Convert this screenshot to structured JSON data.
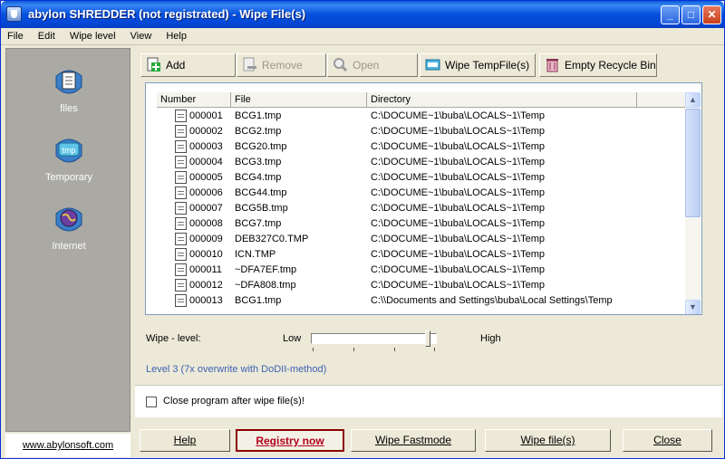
{
  "window": {
    "title": "abylon SHREDDER (not registrated) - Wipe File(s)",
    "buttons": {
      "minimize": "_",
      "maximize": "□",
      "close": "✕"
    }
  },
  "menu": [
    "File",
    "Edit",
    "Wipe level",
    "View",
    "Help"
  ],
  "sidebar": {
    "items": [
      {
        "label": "files",
        "icon": "files-icon"
      },
      {
        "label": "Temporary",
        "icon": "tmp-icon"
      },
      {
        "label": "Internet",
        "icon": "internet-icon"
      }
    ],
    "link": "www.abylonsoft.com"
  },
  "toolbar": {
    "add": "Add",
    "remove": "Remove",
    "open": "Open",
    "wipe_temp": "Wipe TempFile(s)",
    "empty_bin": "Empty Recycle Bin"
  },
  "list": {
    "headers": {
      "number": "Number",
      "file": "File",
      "directory": "Directory"
    },
    "rows": [
      {
        "num": "000001",
        "file": "BCG1.tmp",
        "dir": "C:\\DOCUME~1\\buba\\LOCALS~1\\Temp"
      },
      {
        "num": "000002",
        "file": "BCG2.tmp",
        "dir": "C:\\DOCUME~1\\buba\\LOCALS~1\\Temp"
      },
      {
        "num": "000003",
        "file": "BCG20.tmp",
        "dir": "C:\\DOCUME~1\\buba\\LOCALS~1\\Temp"
      },
      {
        "num": "000004",
        "file": "BCG3.tmp",
        "dir": "C:\\DOCUME~1\\buba\\LOCALS~1\\Temp"
      },
      {
        "num": "000005",
        "file": "BCG4.tmp",
        "dir": "C:\\DOCUME~1\\buba\\LOCALS~1\\Temp"
      },
      {
        "num": "000006",
        "file": "BCG44.tmp",
        "dir": "C:\\DOCUME~1\\buba\\LOCALS~1\\Temp"
      },
      {
        "num": "000007",
        "file": "BCG5B.tmp",
        "dir": "C:\\DOCUME~1\\buba\\LOCALS~1\\Temp"
      },
      {
        "num": "000008",
        "file": "BCG7.tmp",
        "dir": "C:\\DOCUME~1\\buba\\LOCALS~1\\Temp"
      },
      {
        "num": "000009",
        "file": "DEB327C0.TMP",
        "dir": "C:\\DOCUME~1\\buba\\LOCALS~1\\Temp"
      },
      {
        "num": "000010",
        "file": "ICN.TMP",
        "dir": "C:\\DOCUME~1\\buba\\LOCALS~1\\Temp"
      },
      {
        "num": "000011",
        "file": "~DFA7EF.tmp",
        "dir": "C:\\DOCUME~1\\buba\\LOCALS~1\\Temp"
      },
      {
        "num": "000012",
        "file": "~DFA808.tmp",
        "dir": "C:\\DOCUME~1\\buba\\LOCALS~1\\Temp"
      },
      {
        "num": "000013",
        "file": "BCG1.tmp",
        "dir": "C:\\\\Documents and Settings\\buba\\Local Settings\\Temp"
      }
    ]
  },
  "wipe": {
    "label": "Wipe - level:",
    "low": "Low",
    "high": "High",
    "level_fraction": 0.95,
    "level_text": "Level 3 (7x overwrite with DoDII-method)"
  },
  "close_after": "Close program after wipe file(s)!",
  "bottom": {
    "help": "Help",
    "registry": "Registry now",
    "fastmode": "Wipe Fastmode",
    "wipe": "Wipe file(s)",
    "close": "Close"
  },
  "colors": {
    "title_blue": "#0550dc",
    "accent_red": "#b3001b",
    "level_blue": "#3c62b3"
  }
}
